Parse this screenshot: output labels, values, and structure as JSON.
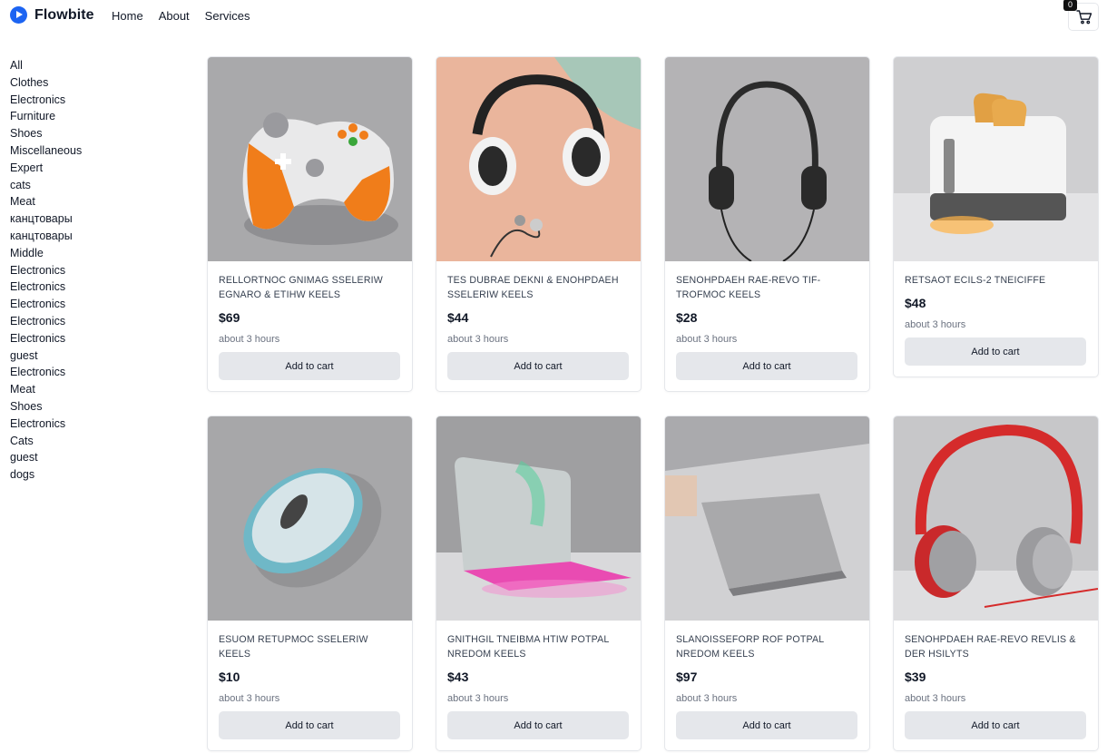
{
  "header": {
    "brand": "Flowbite",
    "nav": [
      "Home",
      "About",
      "Services"
    ],
    "cart_count": "0"
  },
  "categories": [
    "All",
    "Clothes",
    "Electronics",
    "Furniture",
    "Shoes",
    "Miscellaneous",
    "Expert",
    "cats",
    "Meat",
    "канцтовары",
    "канцтовары",
    "Middle",
    "Electronics",
    "Electronics",
    "Electronics",
    "Electronics",
    "Electronics",
    "guest",
    "Electronics",
    "Meat",
    "Shoes",
    "Electronics",
    "Cats",
    "guest",
    "dogs"
  ],
  "products": [
    {
      "title": "RELLORTNOC GNIMAG SSELERIW EGNARO & ETIHW KEELS",
      "price": "$69",
      "time": "about 3 hours",
      "button": "Add to cart"
    },
    {
      "title": "TES DUBRAE DEKNI & ENOHPDAEH SSELERIW KEELS",
      "price": "$44",
      "time": "about 3 hours",
      "button": "Add to cart"
    },
    {
      "title": "SENOHPDAEH RAE-REVO TIF-TROFMOC KEELS",
      "price": "$28",
      "time": "about 3 hours",
      "button": "Add to cart"
    },
    {
      "title": "RETSAOT ECILS-2 TNEICIFFE",
      "price": "$48",
      "time": "about 3 hours",
      "button": "Add to cart"
    },
    {
      "title": "ESUOM RETUPMOC SSELERIW KEELS",
      "price": "$10",
      "time": "about 3 hours",
      "button": "Add to cart"
    },
    {
      "title": "GNITHGIL TNEIBMA HTIW POTPAL NREDOM KEELS",
      "price": "$43",
      "time": "about 3 hours",
      "button": "Add to cart"
    },
    {
      "title": "SLANOISSEFORP ROF POTPAL NREDOM KEELS",
      "price": "$97",
      "time": "about 3 hours",
      "button": "Add to cart"
    },
    {
      "title": "SENOHPDAEH RAE-REVO REVLIS & DER HSILYTS",
      "price": "$39",
      "time": "about 3 hours",
      "button": "Add to cart"
    }
  ],
  "colors": {
    "brand": "#1c64f2",
    "button_bg": "#e5e7eb",
    "border": "#e5e7eb"
  }
}
